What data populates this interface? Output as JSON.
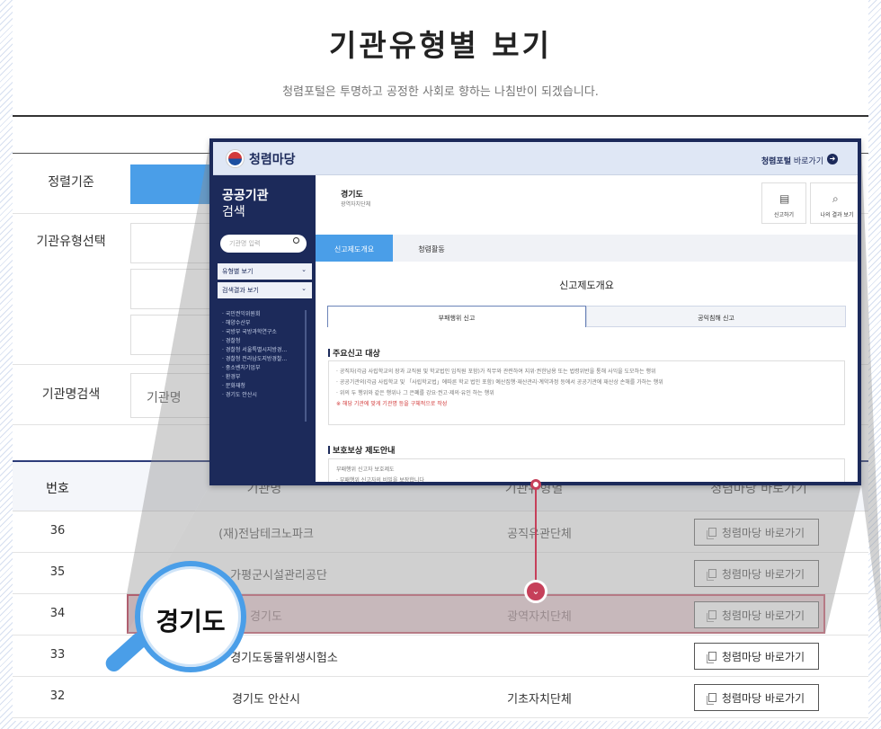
{
  "page": {
    "title": "기관유형별 보기",
    "subtitle": "청렴포털은 투명하고 공정한 사회로 향하는 나침반이 되겠습니다."
  },
  "filters": {
    "sort_label": "정렬기준",
    "type_label": "기관유형선택",
    "name_label": "기관명검색",
    "name_placeholder": "기관명"
  },
  "table": {
    "headers": [
      "번호",
      "기관명",
      "기관유형별",
      "청렴마당 바로가기"
    ],
    "rows": [
      {
        "no": "36",
        "name": "(재)전남테크노파크",
        "type": "공직유관단체",
        "link": "청렴마당 바로가기"
      },
      {
        "no": "35",
        "name": "가평군시설관리공단",
        "type": "",
        "link": "청렴마당 바로가기"
      },
      {
        "no": "34",
        "name": "경기도",
        "type": "광역자치단체",
        "link": "청렴마당 바로가기"
      },
      {
        "no": "33",
        "name": "경기도동물위생시험소",
        "type": "",
        "link": "청렴마당 바로가기"
      },
      {
        "no": "32",
        "name": "경기도 안산시",
        "type": "기초자치단체",
        "link": "청렴마당 바로가기"
      }
    ]
  },
  "magnifier": {
    "text": "경기도"
  },
  "popup": {
    "brand": "청렴마당",
    "portal_link_bold": "청렴포털",
    "portal_link_rest": "바로가기",
    "sidebar": {
      "title_line1": "공공기관",
      "title_line2": "검색",
      "search_placeholder": "기관명 입력",
      "menu1": "유형별 보기",
      "menu2": "검색결과 보기",
      "list": [
        "국민권익위원회",
        "해양수산부",
        "국방부 국방과학연구소",
        "경찰청",
        "경찰청 서울특별시지방경...",
        "경찰청 전라남도지방경찰...",
        "중소벤처기업부",
        "환경부",
        "문화재청",
        "경기도 안산시"
      ]
    },
    "org_name": "경기도",
    "org_type": "광역자치단체",
    "btn_report": "신고하기",
    "btn_result": "나의 결과 보기",
    "tab_active": "신고제도개요",
    "tab_inactive": "청렴활동",
    "section_title": "신고제도개요",
    "subtab_active": "부패행위 신고",
    "subtab_inactive": "공익침해 신고",
    "sec1_title": "주요신고 대상",
    "sec1_items": [
      "· 공직자(각급 사립학교의 장과 교직원 및 학교법인 임직원 포함)가 직무와 관련하여 지위·권한남용 또는 법령위반을 통해 사익을 도모하는 행위",
      "· 공공기관의(각급 사립학교 및 「사립학교법」에따른 학교 법인 포함) 예산집행·재산관리·계약과정 등에서 공공기관에 재산상 손해를 가하는 행위",
      "· 위의 두 행위와 같은 행위나 그 은폐를 강요·권고·제의·유인 하는 행위"
    ],
    "sec1_note": "※ 해당 기관에 맞게 기관명 등을 구체적으로 작성",
    "sec2_title": "보호보상 제도안내",
    "sec2_items": [
      "부패행위 신고자 보호제도",
      "· 부패행위 신고자의 비밀을 보장합니다"
    ]
  }
}
